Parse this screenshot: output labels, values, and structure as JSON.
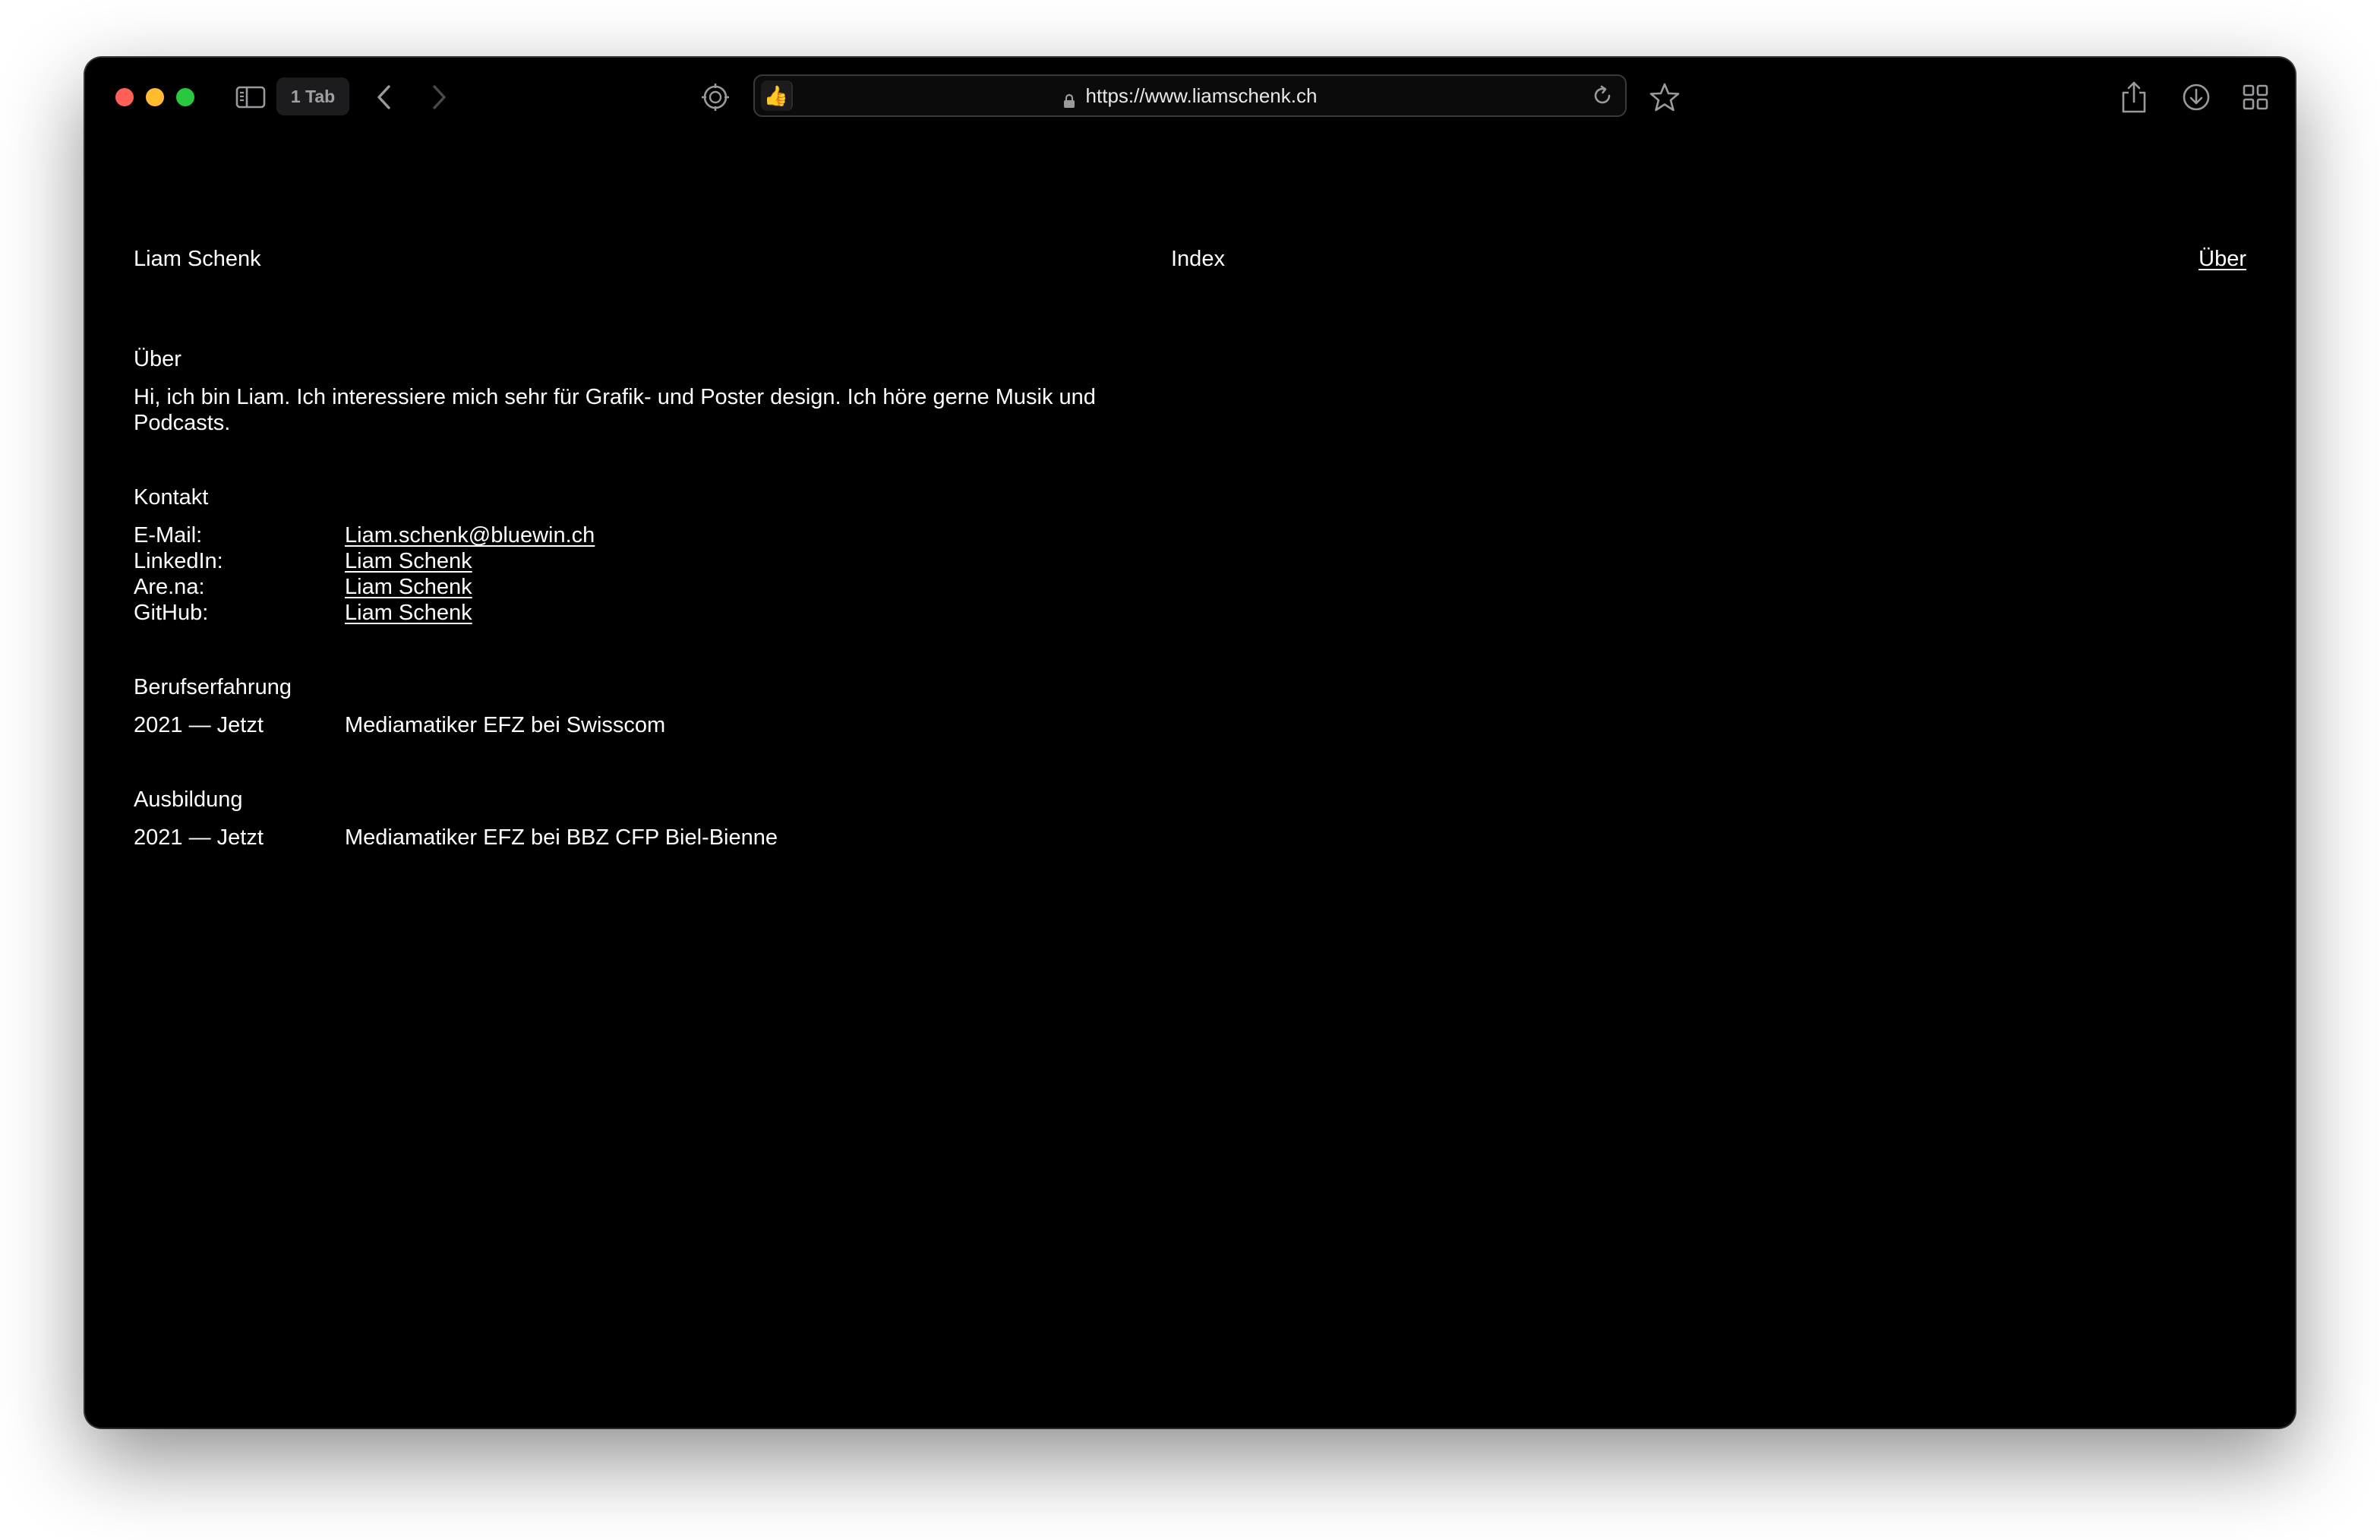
{
  "browser": {
    "tab_count": "1 Tab",
    "url": "https://www.liamschenk.ch",
    "favicon": "👍",
    "icons": {
      "sidebar": "sidebar-icon",
      "back": "chevron-left-icon",
      "forward": "chevron-right-icon",
      "privacy": "privacy-report-icon",
      "lock": "lock-icon",
      "reload": "reload-icon",
      "bookmark": "star-icon",
      "share": "share-icon",
      "downloads": "download-icon",
      "tabs": "tab-overview-icon"
    }
  },
  "site": {
    "name": "Liam Schenk",
    "nav": {
      "index": "Index",
      "about": "Über"
    }
  },
  "about": {
    "title": "Über",
    "text": "Hi, ich bin Liam. Ich interessiere mich sehr für Grafik- und Poster design. Ich höre gerne Musik und Podcasts."
  },
  "contact": {
    "title": "Kontakt",
    "items": [
      {
        "label": "E-Mail:",
        "value": "Liam.schenk@bluewin.ch"
      },
      {
        "label": "LinkedIn:",
        "value": "Liam Schenk"
      },
      {
        "label": "Are.na:",
        "value": "Liam Schenk"
      },
      {
        "label": "GitHub:",
        "value": "Liam Schenk"
      }
    ]
  },
  "experience": {
    "title": "Berufserfahrung",
    "items": [
      {
        "period": "2021 — Jetzt",
        "description": "Mediamatiker EFZ bei Swisscom"
      }
    ]
  },
  "education": {
    "title": "Ausbildung",
    "items": [
      {
        "period": "2021 — Jetzt",
        "description": "Mediamatiker EFZ bei BBZ CFP Biel-Bienne"
      }
    ]
  },
  "colors": {
    "background": "#000000",
    "text": "#ffffff",
    "close": "#ff5f57",
    "minimize": "#febc2e",
    "zoom": "#28c840"
  }
}
